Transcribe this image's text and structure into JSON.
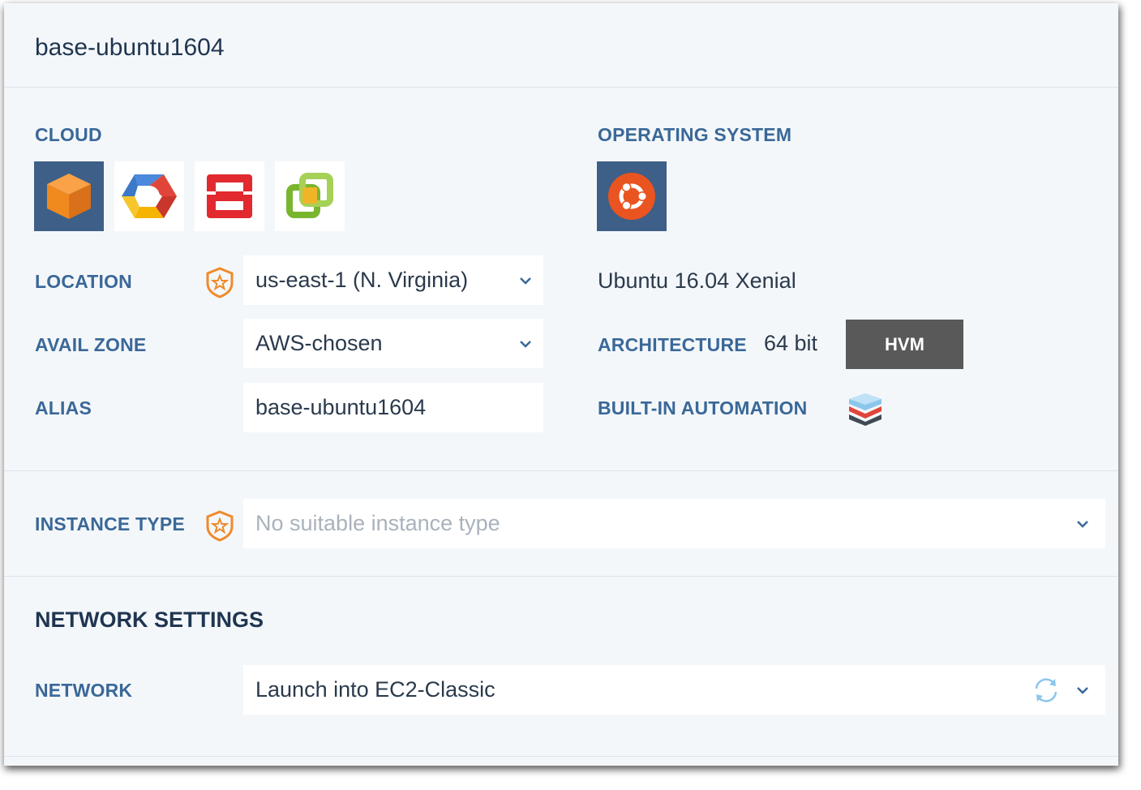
{
  "header": {
    "title": "base-ubuntu1604"
  },
  "cloud": {
    "label": "CLOUD",
    "providers": [
      {
        "name": "aws-cube-icon",
        "selected": true
      },
      {
        "name": "google-cloud-icon",
        "selected": false
      },
      {
        "name": "openstack-icon",
        "selected": false
      },
      {
        "name": "vsphere-icon",
        "selected": false
      }
    ]
  },
  "os": {
    "label": "OPERATING SYSTEM",
    "icon": "ubuntu-icon",
    "name": "Ubuntu 16.04 Xenial"
  },
  "location": {
    "label": "LOCATION",
    "value": "us-east-1 (N. Virginia)"
  },
  "avail_zone": {
    "label": "AVAIL ZONE",
    "value": "AWS-chosen"
  },
  "alias": {
    "label": "ALIAS",
    "value": "base-ubuntu1604"
  },
  "architecture": {
    "label": "ARCHITECTURE",
    "value": "64 bit",
    "virt": "HVM"
  },
  "automation": {
    "label": "BUILT-IN AUTOMATION",
    "icon": "layers-stack-icon"
  },
  "instance_type": {
    "label": "INSTANCE TYPE",
    "placeholder": "No suitable instance type"
  },
  "network_settings": {
    "title": "NETWORK SETTINGS",
    "network_label": "NETWORK",
    "network_value": "Launch into EC2-Classic"
  },
  "colors": {
    "label_blue": "#3a6898",
    "selected_tile": "#3d5f88",
    "badge_orange": "#f08a2a",
    "hvm_bg": "#595959"
  }
}
